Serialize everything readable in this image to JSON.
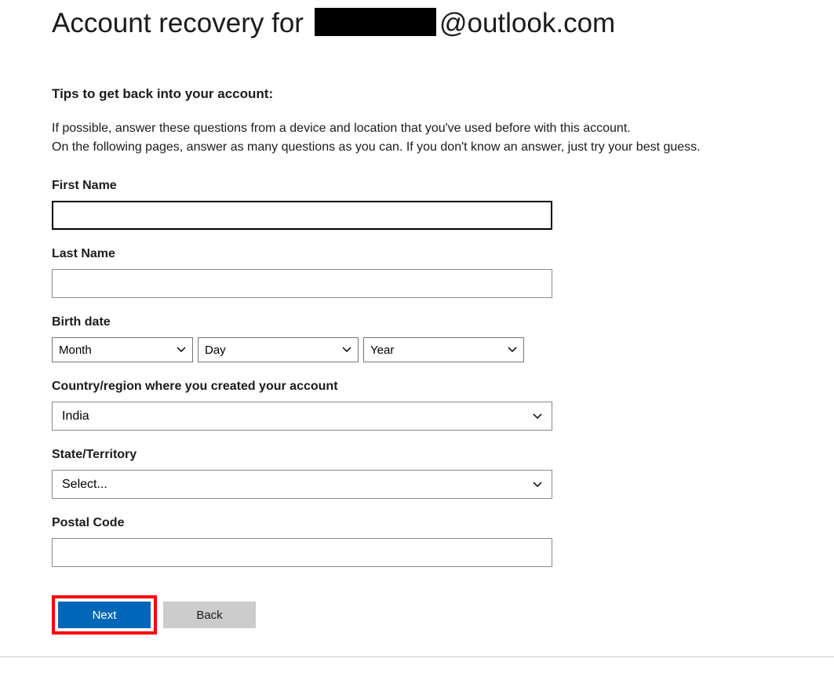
{
  "title": {
    "prefix": "Account recovery for",
    "suffix": "@outlook.com"
  },
  "tips": {
    "heading": "Tips to get back into your account:",
    "line1": "If possible, answer these questions from a device and location that you've used before with this account.",
    "line2": "On the following pages, answer as many questions as you can. If you don't know an answer, just try your best guess."
  },
  "fields": {
    "first_name": {
      "label": "First Name",
      "value": ""
    },
    "last_name": {
      "label": "Last Name",
      "value": ""
    },
    "birth_date": {
      "label": "Birth date",
      "month": "Month",
      "day": "Day",
      "year": "Year"
    },
    "country": {
      "label": "Country/region where you created your account",
      "value": "India"
    },
    "state": {
      "label": "State/Territory",
      "value": "Select..."
    },
    "postal": {
      "label": "Postal Code",
      "value": ""
    }
  },
  "buttons": {
    "next": "Next",
    "back": "Back"
  }
}
